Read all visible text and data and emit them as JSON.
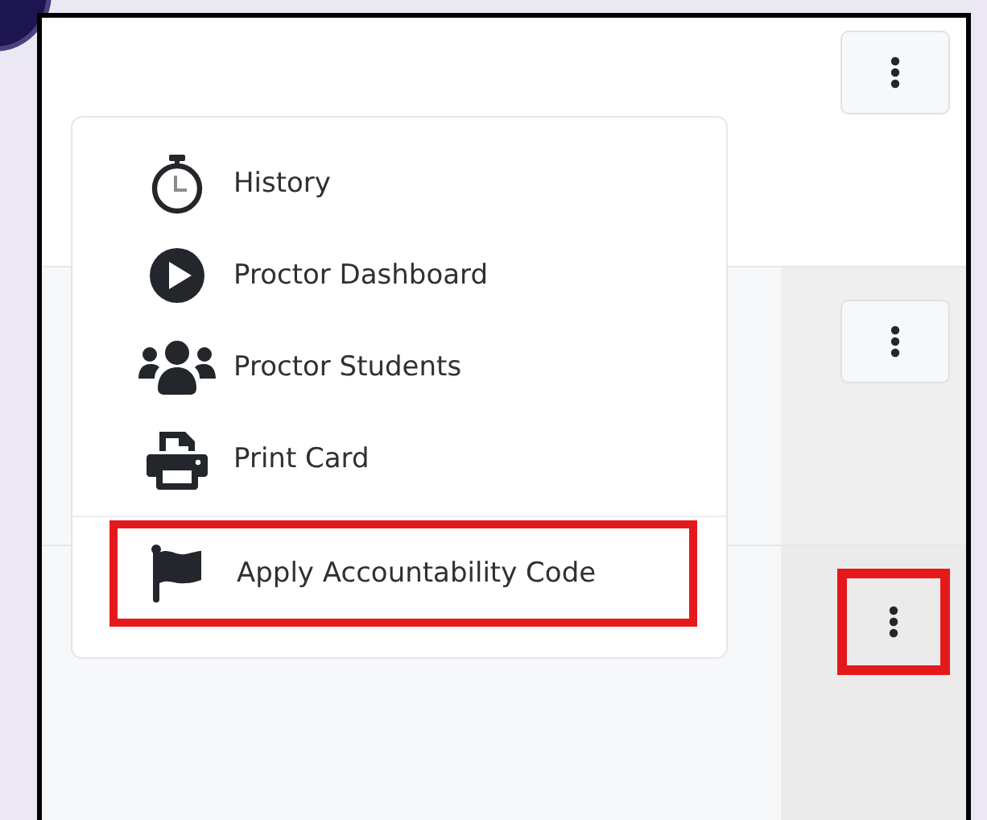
{
  "rows": [
    {
      "actions_button": {
        "highlighted": false
      }
    },
    {
      "actions_button": {
        "highlighted": false
      }
    },
    {
      "actions_button": {
        "highlighted": true
      }
    }
  ],
  "menu": {
    "groups": [
      [
        {
          "kind": "stopwatch",
          "label": "History",
          "highlighted": false
        },
        {
          "kind": "play",
          "label": "Proctor Dashboard",
          "highlighted": false
        },
        {
          "kind": "users",
          "label": "Proctor Students",
          "highlighted": false
        },
        {
          "kind": "printer",
          "label": "Print Card",
          "highlighted": false
        }
      ],
      [
        {
          "kind": "flag",
          "label": "Apply Accountability Code",
          "highlighted": true
        }
      ]
    ]
  }
}
